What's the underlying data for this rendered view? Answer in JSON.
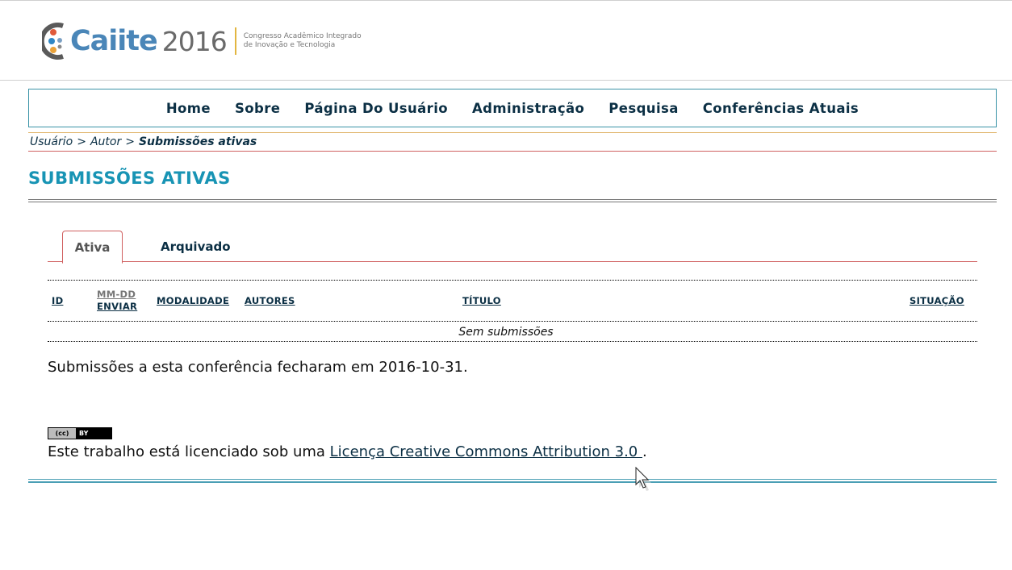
{
  "header": {
    "logo_brand": "Caiite",
    "logo_year": "2016",
    "logo_tagline_line1": "Congresso Acadêmico Integrado",
    "logo_tagline_line2": "de Inovação e Tecnologia"
  },
  "nav": {
    "items": [
      "Home",
      "Sobre",
      "Página Do Usuário",
      "Administração",
      "Pesquisa",
      "Conferências Atuais"
    ]
  },
  "breadcrumb": {
    "items": [
      "Usuário",
      "Autor"
    ],
    "separator": ">",
    "current": "Submissões ativas"
  },
  "page_title": "SUBMISSÕES ATIVAS",
  "tabs": {
    "active": "Ativa",
    "archived": "Arquivado"
  },
  "table": {
    "columns": {
      "id": "ID",
      "date_line1": "MM-DD",
      "date_line2": "ENVIAR",
      "modality": "MODALIDADE",
      "authors": "AUTORES",
      "title": "TÍTULO",
      "status": "SITUAÇÃO"
    },
    "empty_message": "Sem submissões"
  },
  "closed_message": "Submissões a esta conferência fecharam em 2016-10-31.",
  "license": {
    "badge_cc": "(cc)",
    "badge_by": "BY",
    "prefix": "Este trabalho está licenciado sob uma ",
    "link_text": "Licença Creative Commons Attribution 3.0 ",
    "suffix": "."
  },
  "colors": {
    "title": "#1894b4",
    "nav_text": "#0b2f44",
    "tab_border": "#d06060",
    "logo_blue": "#4a86b8"
  },
  "icons": {
    "logo": "caiite-logo-mark",
    "license_badge": "creative-commons-by-icon",
    "cursor": "mouse-pointer-icon"
  }
}
